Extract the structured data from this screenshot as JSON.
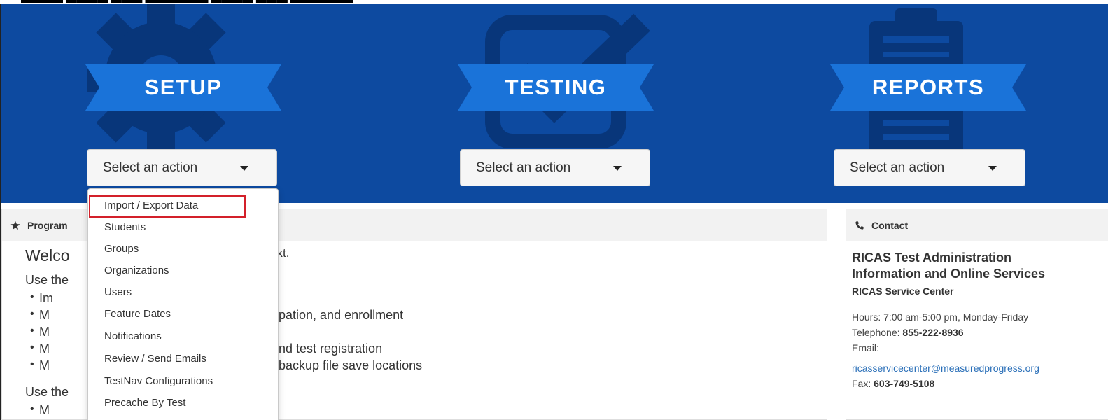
{
  "sections": [
    {
      "title": "SETUP",
      "select_label": "Select an action",
      "watermark_icon": "gear-icon"
    },
    {
      "title": "TESTING",
      "select_label": "Select an action",
      "watermark_icon": "checkbox-icon"
    },
    {
      "title": "REPORTS",
      "select_label": "Select an action",
      "watermark_icon": "clipboard-icon"
    }
  ],
  "setup_menu": {
    "items": [
      {
        "label": "Import / Export Data",
        "highlighted": true
      },
      {
        "label": "Students"
      },
      {
        "label": "Groups"
      },
      {
        "label": "Organizations"
      },
      {
        "label": "Users"
      },
      {
        "label": "Feature Dates"
      },
      {
        "label": "Notifications"
      },
      {
        "label": "Review / Send Emails"
      },
      {
        "label": "TestNav Configurations"
      },
      {
        "label": "Precache By Test"
      }
    ]
  },
  "program_panel": {
    "heading": "Program",
    "heading_icon": "star-icon",
    "welcome_start": "Welco",
    "welcome_tail": "ext",
    "use_line_1": "Use the",
    "use_line_2": "Use the",
    "bullets": [
      "Im",
      "M",
      "M",
      "M",
      "M",
      "M"
    ],
    "fragments": [
      "pation, and enrollment",
      "nd test registration",
      "backup file save locations"
    ]
  },
  "contact_panel": {
    "heading": "Contact",
    "heading_icon": "phone-icon",
    "title_line_1": "RICAS Test Administration",
    "title_line_2": "Information and Online Services",
    "subtitle": "RICAS Service Center",
    "hours": "Hours: 7:00 am-5:00 pm, Monday-Friday",
    "telephone_label": "Telephone:",
    "telephone": "855-222-8936",
    "email_label": "Email:",
    "email": "ricasservicecenter@measuredprogress.org",
    "fax_label": "Fax:",
    "fax": "603-749-5108"
  },
  "colors": {
    "hero_bg": "#0d4aa0",
    "ribbon": "#1a73d9",
    "watermark": "#08367a",
    "highlight_border": "#d3202a",
    "link": "#2a6fb8"
  }
}
